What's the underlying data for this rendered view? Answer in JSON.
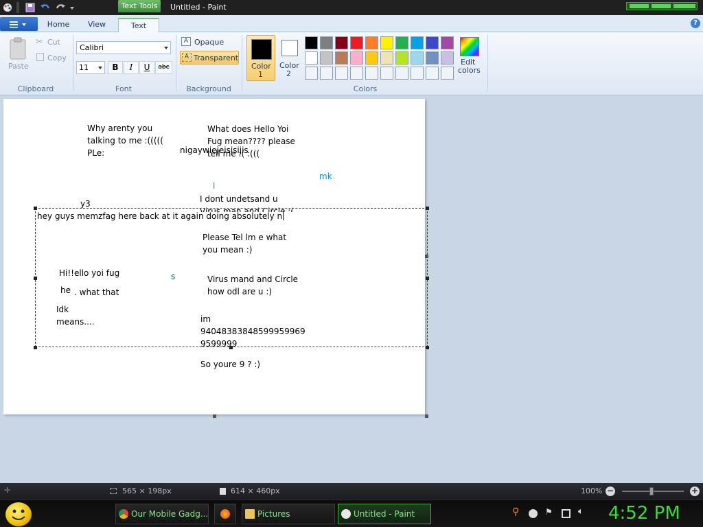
{
  "titlebar": {
    "context_tab": "Text Tools",
    "window_title": "Untitled - Paint"
  },
  "tabs": {
    "home": "Home",
    "view": "View",
    "text": "Text"
  },
  "ribbon": {
    "clipboard": {
      "paste": "Paste",
      "cut": "Cut",
      "copy": "Copy",
      "label": "Clipboard"
    },
    "font": {
      "family": "Calibri",
      "size": "11",
      "bold": "B",
      "italic": "I",
      "underline": "U",
      "strike": "abc",
      "label": "Font"
    },
    "background": {
      "opaque": "Opaque",
      "transparent": "Transparent",
      "label": "Background"
    },
    "colors": {
      "color1_label": "Color",
      "color1_num": "1",
      "color2_label": "Color",
      "color2_num": "2",
      "edit_label": "Edit",
      "edit_label2": "colors",
      "label": "Colors",
      "color1_value": "#000000",
      "color2_value": "#ffffff",
      "palette_row1": [
        "#000000",
        "#7f7f7f",
        "#880015",
        "#ed1c24",
        "#ff7f27",
        "#fff200",
        "#22b14c",
        "#00a2e8",
        "#3f48cc",
        "#a349a4"
      ],
      "palette_row2": [
        "#ffffff",
        "#c3c3c3",
        "#b97a57",
        "#ffaec9",
        "#ffc90e",
        "#efe4b0",
        "#b5e61d",
        "#99d9ea",
        "#7092be",
        "#c8bfe7"
      ],
      "palette_row3": [
        "#f0f4f9",
        "#f0f4f9",
        "#f0f4f9",
        "#f0f4f9",
        "#f0f4f9",
        "#f0f4f9",
        "#f0f4f9",
        "#f0f4f9",
        "#f0f4f9",
        "#f0f4f9"
      ]
    }
  },
  "canvas": {
    "texts": [
      "Why arenty you",
      "talking to me :(((((",
      "PLe:",
      "What does Hello Yoi",
      "Fug mean???? please",
      "tell me :( :(((",
      "nigaywiejeisisijis",
      "mk",
      "l",
      "I dont undetsand u",
      "Virus man and Circle :(",
      "y3",
      "hey guys memzfag here back at it again doing absolutely n",
      "Please Tel lm e what",
      "you mean :)",
      "Hi!!ello yoi fug",
      "s",
      "he",
      ". what that",
      "Virus mand and Circle",
      "how odl are u :)",
      "Idk",
      "means....",
      "im",
      "94048383848599959969",
      "9599999",
      "So youre 9 ? :)"
    ]
  },
  "status": {
    "selection_size": "565 × 198px",
    "canvas_size": "614 × 460px",
    "zoom": "100%"
  },
  "taskbar": {
    "items": [
      "Our Mobile Gadg...",
      "Pictures",
      "Untitled - Paint"
    ],
    "clock": "4:52 PM"
  }
}
